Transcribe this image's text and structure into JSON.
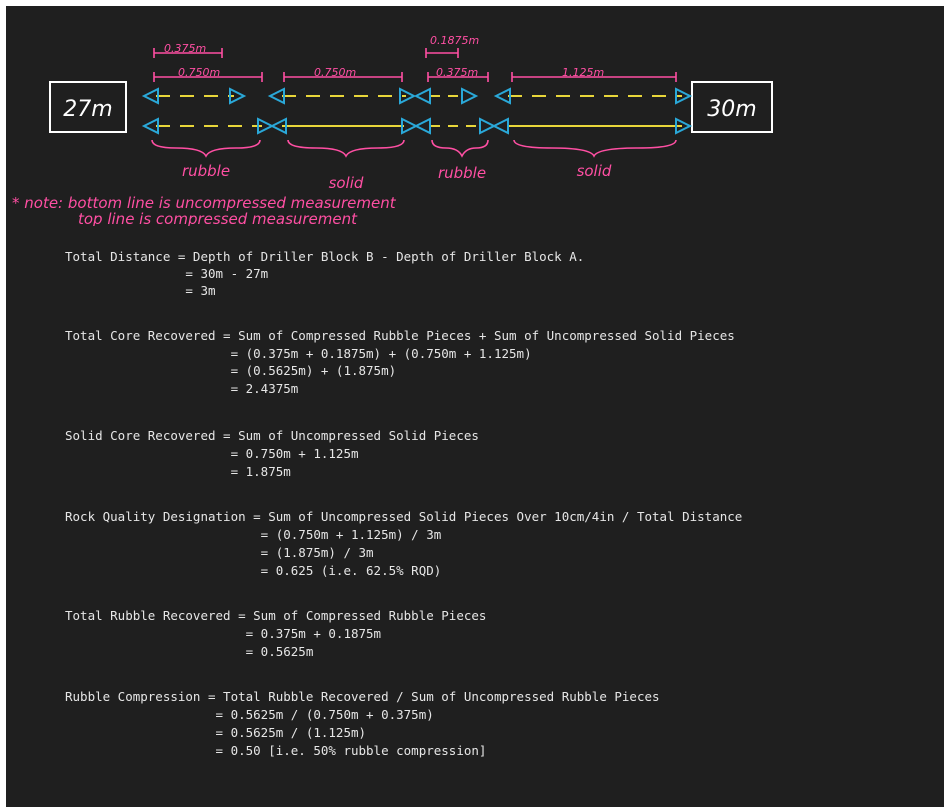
{
  "diagram": {
    "block_a": "27m",
    "block_b": "30m",
    "dims": {
      "rubble1_compressed": "0.375m",
      "rubble1_full": "0.750m",
      "solid1": "0.750m",
      "rubble2_compressed": "0.1875m",
      "rubble2_full": "0.375m",
      "solid2": "1.125m"
    },
    "section_labels": [
      "rubble",
      "solid",
      "rubble",
      "solid"
    ],
    "note_line1": "* note: bottom line is uncompressed measurement",
    "note_line2": "top line is compressed measurement",
    "colors": {
      "background": "#1f1f1f",
      "text": "#e6e6e6",
      "pink": "#ff4fa3",
      "yellow": "#e8d63a",
      "cyan": "#2aa8d8",
      "white": "#ffffff"
    }
  },
  "equations": [
    {
      "id": "total-distance",
      "lines": [
        "Total Distance = Depth of Driller Block B - Depth of Driller Block A.",
        "                = 30m - 27m",
        "                = 3m"
      ]
    },
    {
      "id": "total-core",
      "lines": [
        "Total Core Recovered = Sum of Compressed Rubble Pieces + Sum of Uncompressed Solid Pieces",
        "                      = (0.375m + 0.1875m) + (0.750m + 1.125m)",
        "                      = (0.5625m) + (1.875m)",
        "                      = 2.4375m"
      ]
    },
    {
      "id": "solid-core",
      "lines": [
        "Solid Core Recovered = Sum of Uncompressed Solid Pieces",
        "                      = 0.750m + 1.125m",
        "                      = 1.875m"
      ]
    },
    {
      "id": "rqd",
      "lines": [
        "Rock Quality Designation = Sum of Uncompressed Solid Pieces Over 10cm/4in / Total Distance",
        "                          = (0.750m + 1.125m) / 3m",
        "                          = (1.875m) / 3m",
        "                          = 0.625 (i.e. 62.5% RQD)"
      ]
    },
    {
      "id": "total-rubble",
      "lines": [
        "Total Rubble Recovered = Sum of Compressed Rubble Pieces",
        "                        = 0.375m + 0.1875m",
        "                        = 0.5625m"
      ]
    },
    {
      "id": "rubble-compression",
      "lines": [
        "Rubble Compression = Total Rubble Recovered / Sum of Uncompressed Rubble Pieces",
        "                    = 0.5625m / (0.750m + 0.375m)",
        "                    = 0.5625m / (1.125m)",
        "                    = 0.50 [i.e. 50% rubble compression]"
      ]
    }
  ]
}
